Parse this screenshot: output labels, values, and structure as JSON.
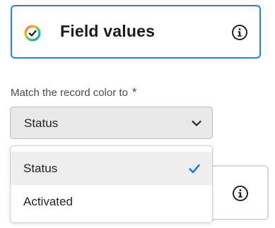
{
  "card": {
    "title": "Field values",
    "icon": "color-wheel-icon",
    "info_icon": "info-icon"
  },
  "field": {
    "label": "Match the record color to",
    "required_mark": "*"
  },
  "picker": {
    "value": "Status",
    "icon": "chevron-down-icon"
  },
  "menu": {
    "items": [
      {
        "label": "Status",
        "selected": true
      },
      {
        "label": "Activated",
        "selected": false
      }
    ],
    "check_icon": "checkmark-icon"
  },
  "colors": {
    "accent": "#2680eb",
    "check": "#1473e6",
    "picker_bg": "#e9e9e9"
  }
}
